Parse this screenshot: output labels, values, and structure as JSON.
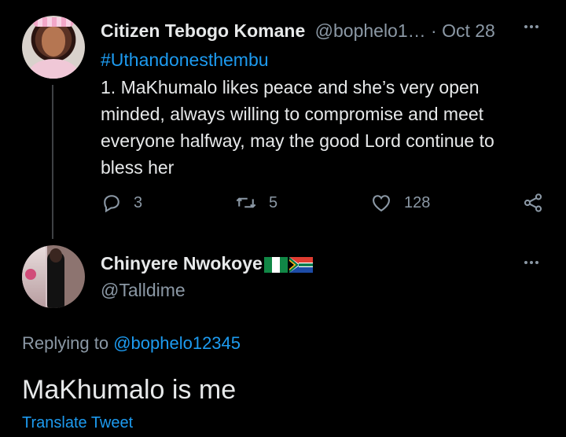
{
  "tweet1": {
    "author_name": "Citizen Tebogo Komane",
    "handle": "@bophelo1…",
    "separator": "·",
    "date": "Oct 28",
    "hashtag": "#Uthandonesthembu",
    "text": "1. MaKhumalo likes peace and she’s very open minded, always willing to compromise and meet everyone halfway, may the good Lord continue to bless her",
    "replies": "3",
    "retweets": "5",
    "likes": "128"
  },
  "tweet2": {
    "author_name": "Chinyere Nwokoye",
    "handle": "@Talldime",
    "replying_prefix": "Replying to",
    "replying_to": "@bophelo12345",
    "text": "MaKhumalo is me",
    "translate_label": "Translate Tweet"
  },
  "colors": {
    "background": "#000000",
    "text": "#e7e9ea",
    "muted": "#8b98a5",
    "link": "#1d9bf0"
  },
  "icons": [
    "more-icon",
    "reply-icon",
    "retweet-icon",
    "like-icon",
    "share-icon",
    "nigeria-flag-icon",
    "south-africa-flag-icon"
  ]
}
